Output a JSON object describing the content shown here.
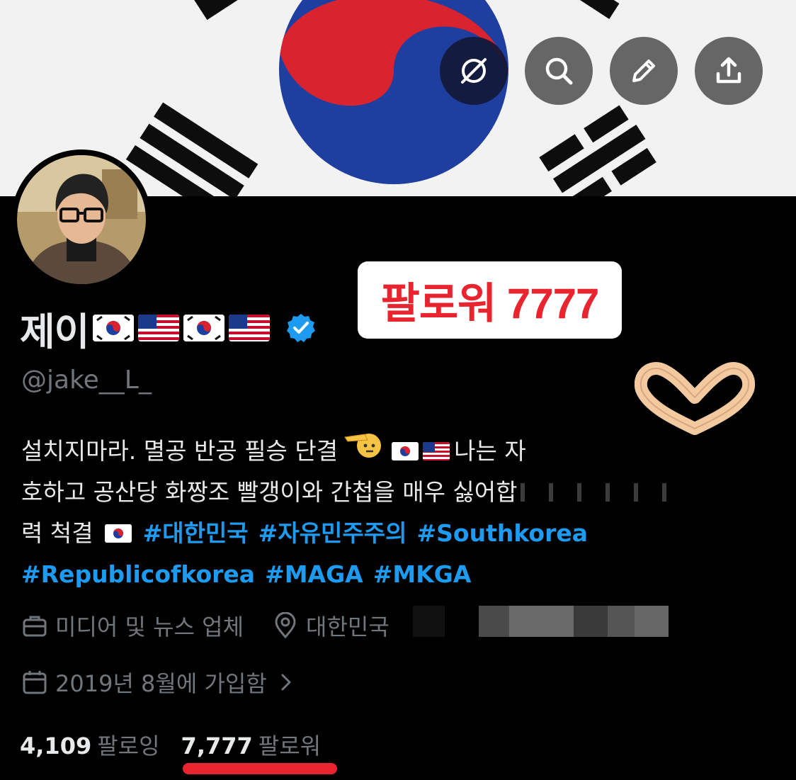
{
  "profile": {
    "display_name": "제이",
    "flags": [
      "kr-flag",
      "us-flag",
      "kr-flag",
      "us-flag"
    ],
    "handle": "@jake__L_",
    "verified": true
  },
  "header_buttons": [
    {
      "name": "grok-icon"
    },
    {
      "name": "search-icon"
    },
    {
      "name": "edit-icon"
    },
    {
      "name": "share-icon"
    }
  ],
  "bio": {
    "line1": "설치지마라. 멸공 반공 필승 단결",
    "line1_tail": "나는 자",
    "line2": "호하고 공산당 화짱조 빨갱이와 간첩을 매우 싫어합",
    "line3_text": "력 척결",
    "hashtags_line3": [
      "#대한민국",
      "#자유민주주의",
      "#Southkorea"
    ],
    "hashtags_line4": [
      "#Republicofkorea",
      "#MAGA",
      "#MKGA"
    ]
  },
  "meta": {
    "category": "미디어 및 뉴스 업체",
    "location": "대한민국",
    "joined": "2019년 8월에 가입함"
  },
  "stats": {
    "following_count": "4,109",
    "following_label": "팔로잉",
    "followers_count": "7,777",
    "followers_label": "팔로워"
  },
  "overlay": {
    "callout_text": "팔로워 7777",
    "callout_color": "#e8252f",
    "heart_icon": "heart-hands-icon"
  },
  "colors": {
    "background": "#000000",
    "link": "#1d9bf0",
    "muted": "#71767b",
    "text": "#e7e9ea",
    "verified": "#1d9bf0"
  }
}
